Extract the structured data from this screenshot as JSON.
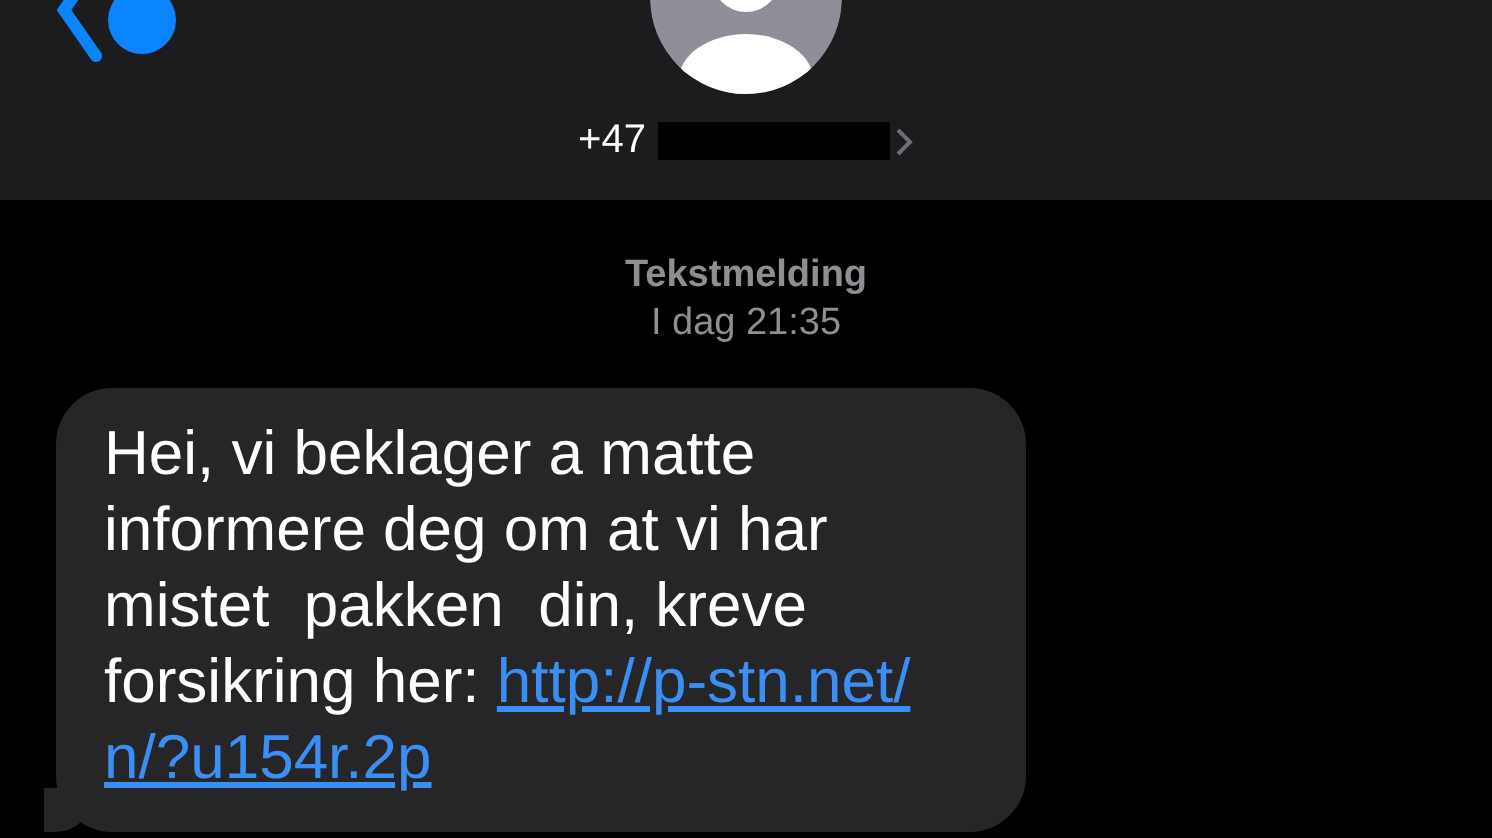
{
  "header": {
    "contact": "+47"
  },
  "timestamp": {
    "service": "Tekstmelding",
    "time": "I dag 21:35"
  },
  "messages": [
    {
      "kind": "incoming",
      "text": "Hei, vi beklager a matte\ninformere deg om at vi har\nmistet  pakken  din, kreve\nforsikring her: ",
      "link_lines": [
        "http://p-stn.net/",
        "n/?u154r.2p"
      ]
    }
  ]
}
